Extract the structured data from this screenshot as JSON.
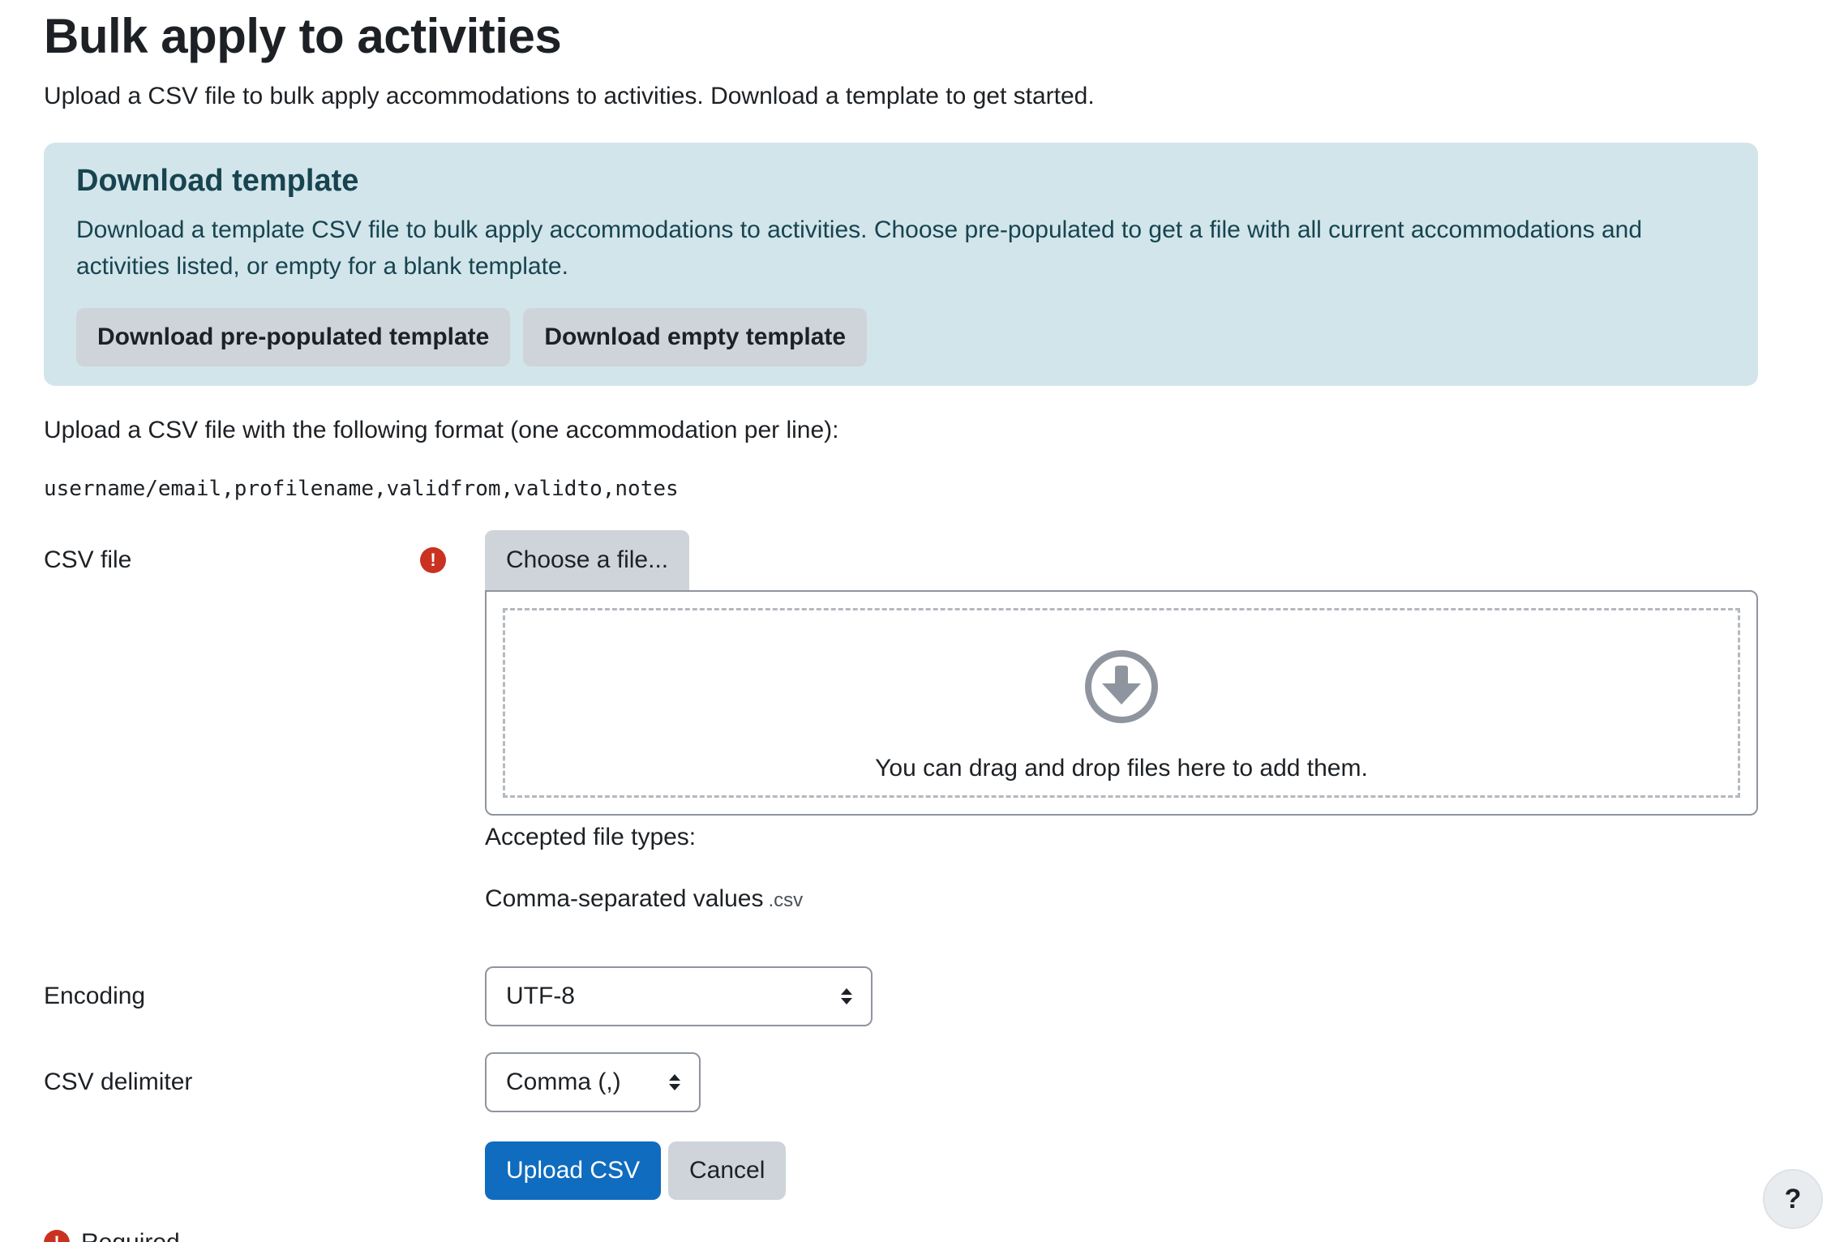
{
  "page": {
    "title": "Bulk apply to activities",
    "intro": "Upload a CSV file to bulk apply accommodations to activities. Download a template to get started."
  },
  "template_box": {
    "heading": "Download template",
    "text": "Download a template CSV file to bulk apply accommodations to activities. Choose pre-populated to get a file with all current accommodations and activities listed, or empty for a blank template.",
    "prepopulated_label": "Download pre-populated template",
    "empty_label": "Download empty template"
  },
  "format": {
    "text": "Upload a CSV file with the following format (one accommodation per line):",
    "code": "username/email,profilename,validfrom,validto,notes"
  },
  "form": {
    "csv_file_label": "CSV file",
    "required_icon": "!",
    "choose_file_label": "Choose a file...",
    "dropzone_text": "You can drag and drop files here to add them.",
    "accepted_label": "Accepted file types:",
    "accepted_type_name": "Comma-separated values",
    "accepted_type_ext": ".csv",
    "encoding_label": "Encoding",
    "encoding_value": "UTF-8",
    "delimiter_label": "CSV delimiter",
    "delimiter_value": "Comma (,)",
    "upload_label": "Upload CSV",
    "cancel_label": "Cancel",
    "required_text": "Required"
  },
  "help": {
    "label": "?"
  },
  "colors": {
    "primary": "#0f6cbf",
    "info_bg": "#d2e5ea",
    "required": "#ca3120",
    "secondary_btn": "#ced4da"
  },
  "icons": {
    "required": "exclamation-circle-icon",
    "dropzone": "arrow-circle-down-icon",
    "select": "sort-arrows-icon",
    "help": "question-icon"
  }
}
